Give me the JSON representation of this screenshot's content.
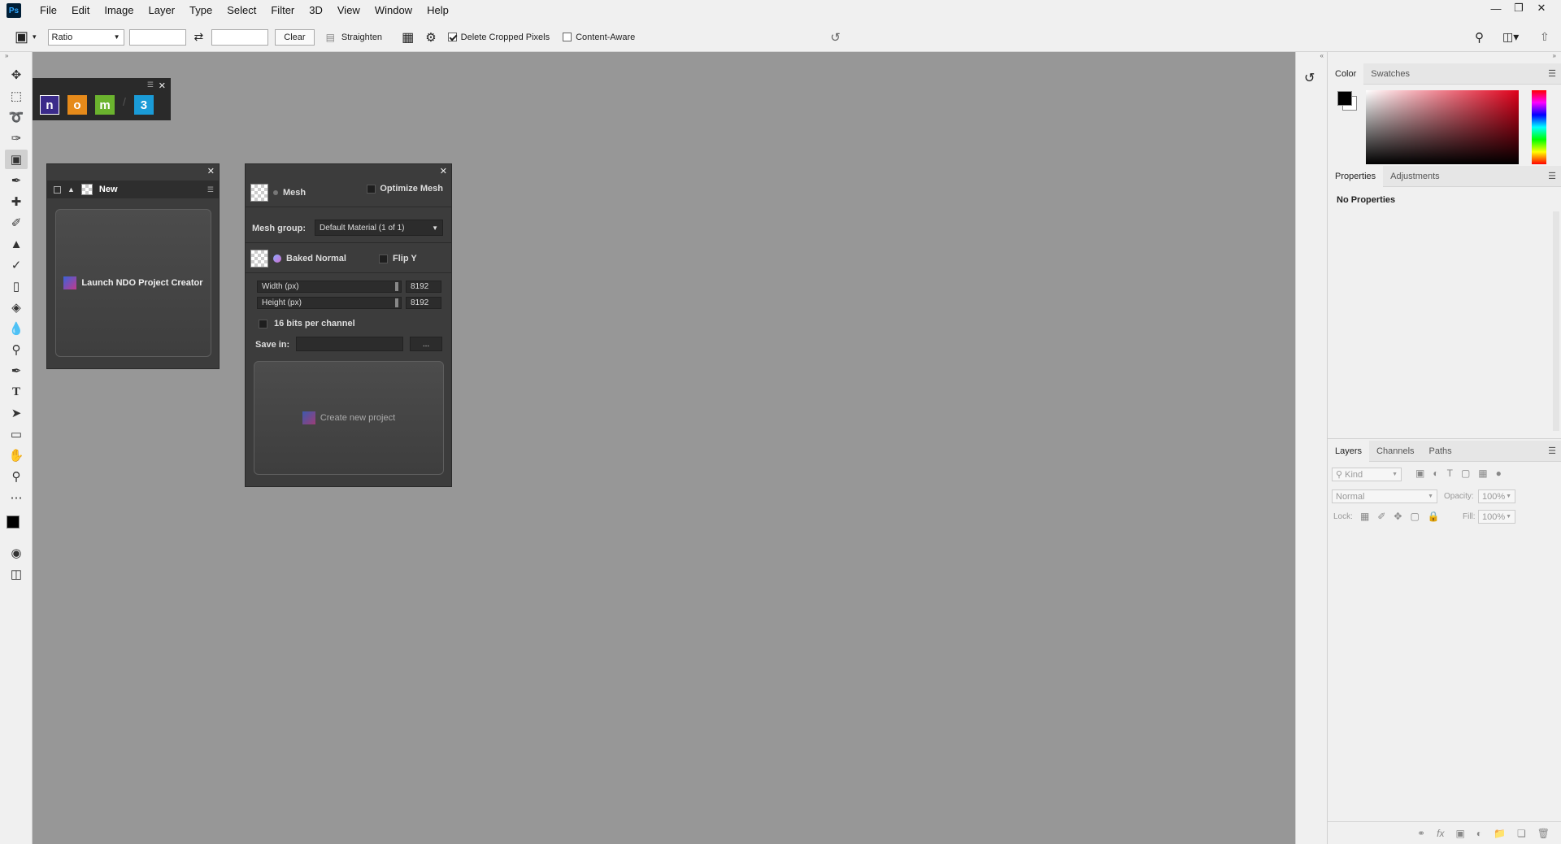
{
  "app": {
    "logo": "Ps"
  },
  "menu": [
    "File",
    "Edit",
    "Image",
    "Layer",
    "Type",
    "Select",
    "Filter",
    "3D",
    "View",
    "Window",
    "Help"
  ],
  "options": {
    "ratio": "Ratio",
    "clear": "Clear",
    "straighten": "Straighten",
    "delete_cropped": "Delete Cropped Pixels",
    "content_aware": "Content-Aware"
  },
  "ndo_panel": {
    "tab": "New",
    "launch": "Launch NDO Project Creator"
  },
  "mesh_panel": {
    "mesh": "Mesh",
    "optimize": "Optimize Mesh",
    "mesh_group_label": "Mesh group:",
    "mesh_group_value": "Default Material (1 of 1)",
    "baked": "Baked Normal",
    "flip": "Flip Y",
    "width_label": "Width (px)",
    "width_value": "8192",
    "height_label": "Height (px)",
    "height_value": "8192",
    "bits": "16 bits per channel",
    "save_in": "Save in:",
    "browse": "...",
    "create": "Create new project"
  },
  "plugin_icons": [
    "n",
    "o",
    "m",
    "3"
  ],
  "color_panel": {
    "tabs": [
      "Color",
      "Swatches"
    ]
  },
  "properties_panel": {
    "tabs": [
      "Properties",
      "Adjustments"
    ],
    "empty": "No Properties"
  },
  "layers_panel": {
    "tabs": [
      "Layers",
      "Channels",
      "Paths"
    ],
    "kind": "Kind",
    "blend": "Normal",
    "opacity_label": "Opacity:",
    "opacity": "100%",
    "lock_label": "Lock:",
    "fill_label": "Fill:",
    "fill": "100%"
  },
  "colors": {
    "accent": "#2d7fd3",
    "canvas": "#979797",
    "panel_dark": "#3c3c3c"
  }
}
